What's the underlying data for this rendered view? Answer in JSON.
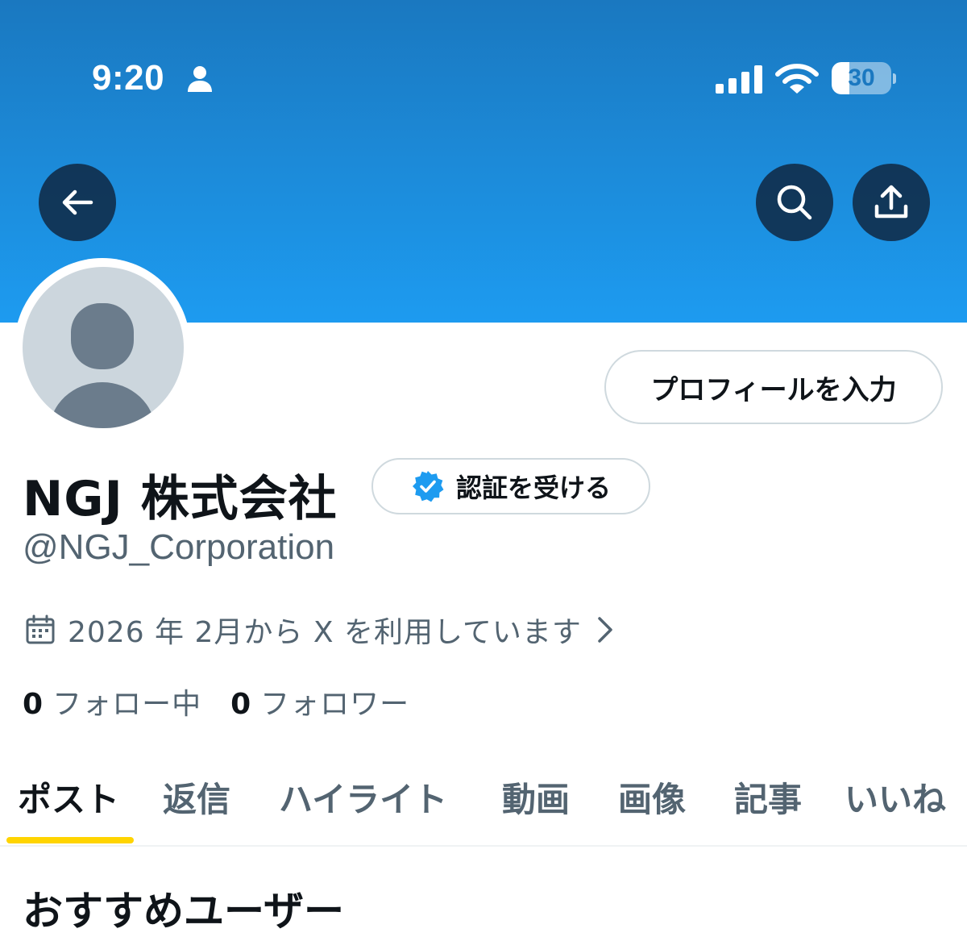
{
  "status_bar": {
    "time": "9:20",
    "battery_level": "30",
    "battery_fraction": 0.3,
    "icons": [
      "person-icon",
      "cellular-signal-icon",
      "wifi-icon",
      "battery-icon"
    ]
  },
  "header": {
    "back_icon": "arrow-left-icon",
    "search_icon": "search-icon",
    "share_icon": "share-icon"
  },
  "profile": {
    "edit_button": "プロフィールを入力",
    "display_name": "NGJ 株式会社",
    "verify_button": "認証を受ける",
    "handle": "@NGJ_Corporation",
    "joined": "2026 年 2月から X を利用しています",
    "following_count": "0",
    "following_label": "フォロー中",
    "followers_count": "0",
    "followers_label": "フォロワー"
  },
  "tabs": [
    {
      "label": "ポスト",
      "active": true
    },
    {
      "label": "返信"
    },
    {
      "label": "ハイライト"
    },
    {
      "label": "動画"
    },
    {
      "label": "画像"
    },
    {
      "label": "記事"
    },
    {
      "label": "いいね"
    }
  ],
  "recommendations": {
    "title": "おすすめユーザー"
  },
  "colors": {
    "accent": "#1d9bf0",
    "tab_indicator": "#ffd400",
    "text_primary": "#0f1419",
    "text_secondary": "#536471",
    "border": "#cfd9de"
  }
}
